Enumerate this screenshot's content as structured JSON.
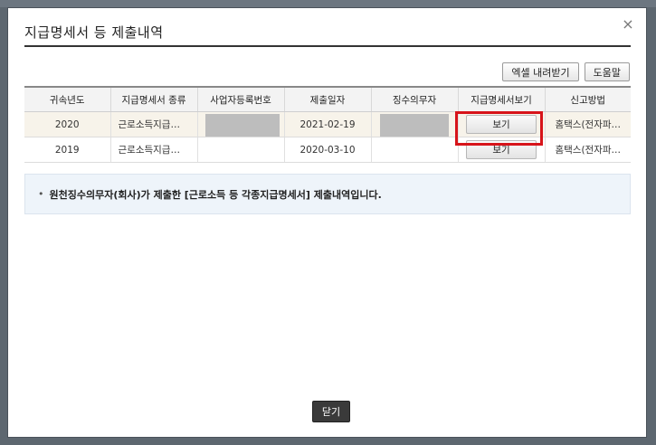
{
  "dialog": {
    "title": "지급명세서 등 제출내역",
    "close_icon": "×"
  },
  "toolbar": {
    "excel_label": "엑셀 내려받기",
    "help_label": "도움말"
  },
  "table": {
    "headers": [
      "귀속년도",
      "지급명세서 종류",
      "사업자등록번호",
      "제출일자",
      "징수의무자",
      "지급명세서보기",
      "신고방법"
    ],
    "rows": [
      {
        "year": "2020",
        "type": "근로소득지급…",
        "submit_date": "2021-02-19",
        "view_label": "보기",
        "method": "홈택스(전자파…"
      },
      {
        "year": "2019",
        "type": "근로소득지급…",
        "submit_date": "2020-03-10",
        "view_label": "보기",
        "method": "홈택스(전자파…"
      }
    ]
  },
  "notice": {
    "bullet": "•",
    "text": "원천징수의무자(회사)가 제출한 [근로소득 등 각종지급명세서] 제출내역입니다."
  },
  "footer": {
    "close_label": "닫기"
  },
  "colors": {
    "highlight": "#d7141a",
    "notice_bg": "#eef4fa",
    "row_highlight_bg": "#f7f3ea",
    "close_button_bg": "#3a3a3a"
  }
}
